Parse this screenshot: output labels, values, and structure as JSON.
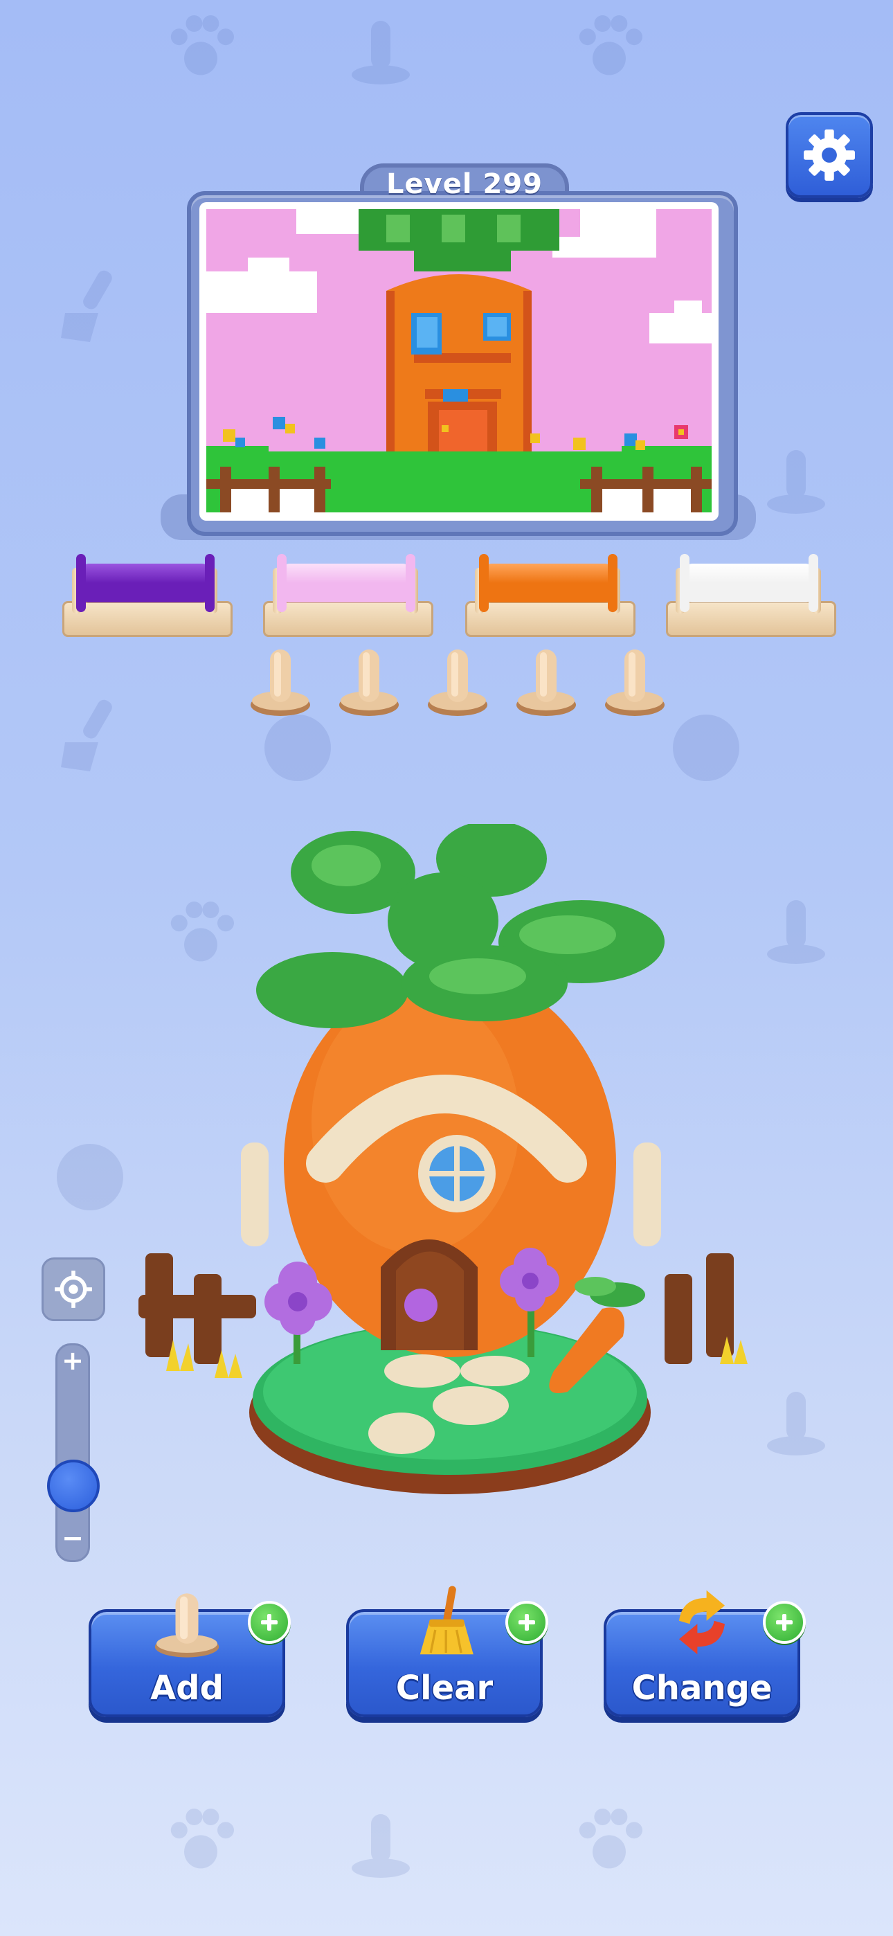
{
  "level": {
    "label": "Level 299"
  },
  "settings": {
    "icon": "gear-icon"
  },
  "spools": [
    {
      "color": "#6a1fb8",
      "highlight": "#9a55e0"
    },
    {
      "color": "#f2b7ef",
      "highlight": "#fbe0f9"
    },
    {
      "color": "#ee7412",
      "highlight": "#ffa55a"
    },
    {
      "color": "#f2f2f2",
      "highlight": "#ffffff"
    }
  ],
  "empty_pegs": 5,
  "zoom": {
    "plus": "+",
    "minus": "−",
    "level": 0.33
  },
  "actions": [
    {
      "label": "Add",
      "icon": "peg-icon"
    },
    {
      "label": "Clear",
      "icon": "broom-icon"
    },
    {
      "label": "Change",
      "icon": "swap-arrows-icon"
    }
  ],
  "colors": {
    "accent": "#3566dc",
    "sky": "#f0a6e6",
    "grass": "#2fc43a",
    "carrot": "#ee7a1a",
    "leaf": "#2f9c35"
  }
}
